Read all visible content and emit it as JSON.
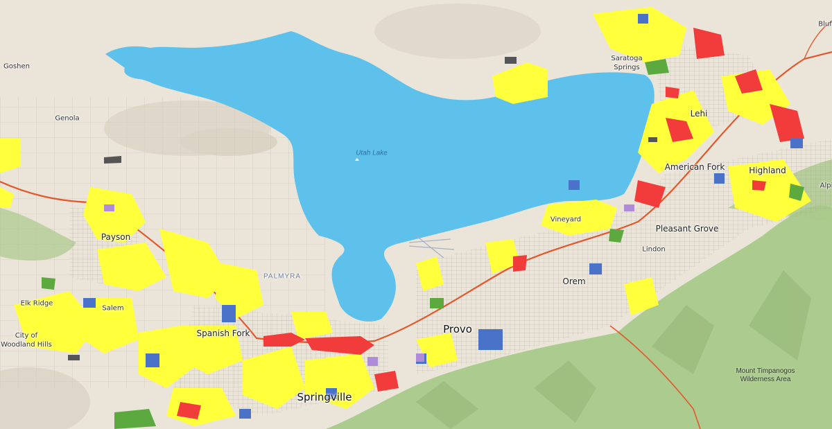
{
  "map": {
    "colors": {
      "land": "#ebe5d9",
      "water": "#5ec1ec",
      "mountain_green": "#a9c98a",
      "residential": "#ffff3b",
      "commercial": "#f23b3b",
      "institutional": "#4a72c9",
      "park": "#5caa3f",
      "industrial": "#b08bd8",
      "highway": "#e2572b",
      "roads": "#9a958c"
    },
    "water_label": "Utah Lake",
    "places": [
      {
        "id": "goshen",
        "name": "Goshen",
        "size": "sm"
      },
      {
        "id": "genola",
        "name": "Genola",
        "size": "sm"
      },
      {
        "id": "payson",
        "name": "Payson",
        "size": "md"
      },
      {
        "id": "elk-ridge",
        "name": "Elk Ridge",
        "size": "sm"
      },
      {
        "id": "salem",
        "name": "Salem",
        "size": "sm"
      },
      {
        "id": "woodland-hills",
        "name": "City of Woodland Hills",
        "size": "sm"
      },
      {
        "id": "spanish-fork",
        "name": "Spanish Fork",
        "size": "md"
      },
      {
        "id": "springville",
        "name": "Springville",
        "size": "lg"
      },
      {
        "id": "provo",
        "name": "Provo",
        "size": "lg"
      },
      {
        "id": "orem",
        "name": "Orem",
        "size": "md"
      },
      {
        "id": "vineyard",
        "name": "Vineyard",
        "size": "sm"
      },
      {
        "id": "lindon",
        "name": "Lindon",
        "size": "sm"
      },
      {
        "id": "pleasant-grove",
        "name": "Pleasant Grove",
        "size": "md"
      },
      {
        "id": "american-fork",
        "name": "American Fork",
        "size": "md"
      },
      {
        "id": "highland",
        "name": "Highland",
        "size": "md"
      },
      {
        "id": "lehi",
        "name": "Lehi",
        "size": "md"
      },
      {
        "id": "saratoga-springs",
        "name": "Saratoga Springs",
        "size": "sm"
      },
      {
        "id": "alpine",
        "name": "Alpi",
        "size": "sm"
      },
      {
        "id": "bluffdale",
        "name": "Bluf",
        "size": "sm"
      }
    ],
    "area_labels": [
      {
        "id": "palmyra",
        "name": "PALMYRA"
      }
    ],
    "wilderness_label": "Mount Timpanogos Wilderness Area"
  }
}
